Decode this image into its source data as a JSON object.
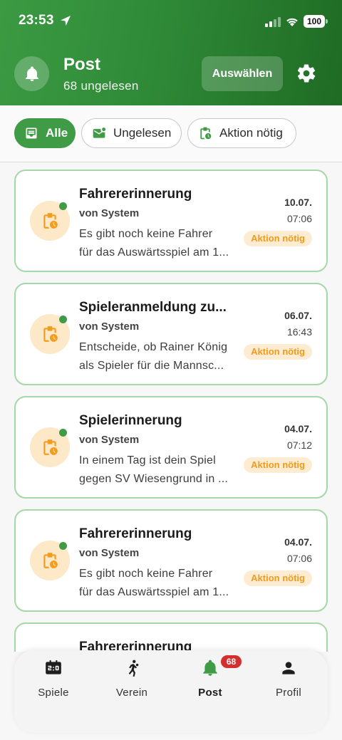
{
  "status_bar": {
    "time": "23:53",
    "battery": "100"
  },
  "header": {
    "title": "Post",
    "subtitle": "68 ungelesen",
    "select_label": "Auswählen"
  },
  "filters": [
    {
      "label": "Alle",
      "active": true
    },
    {
      "label": "Ungelesen",
      "active": false
    },
    {
      "label": "Aktion nötig",
      "active": false
    }
  ],
  "messages": [
    {
      "title": "Fahrererinnerung",
      "sender": "von System",
      "preview_1": "Es gibt noch keine Fahrer",
      "preview_2": "für das Auswärtsspiel am 1...",
      "date": "10.07.",
      "time": "07:06",
      "badge": "Aktion nötig"
    },
    {
      "title": "Spieleranmeldung zu...",
      "sender": "von System",
      "preview_1": "Entscheide, ob Rainer König",
      "preview_2": "als Spieler für die Mannsc...",
      "date": "06.07.",
      "time": "16:43",
      "badge": "Aktion nötig"
    },
    {
      "title": "Spielerinnerung",
      "sender": "von System",
      "preview_1": "In einem Tag ist dein Spiel",
      "preview_2": "gegen SV Wiesengrund in ...",
      "date": "04.07.",
      "time": "07:12",
      "badge": "Aktion nötig"
    },
    {
      "title": "Fahrererinnerung",
      "sender": "von System",
      "preview_1": "Es gibt noch keine Fahrer",
      "preview_2": "für das Auswärtsspiel am 1...",
      "date": "04.07.",
      "time": "07:06",
      "badge": "Aktion nötig"
    },
    {
      "title": "Fahrererinnerung",
      "sender": "",
      "preview_1": "",
      "preview_2": "",
      "date": "",
      "time": "",
      "badge": ""
    }
  ],
  "nav": {
    "items": [
      {
        "label": "Spiele"
      },
      {
        "label": "Verein"
      },
      {
        "label": "Post"
      },
      {
        "label": "Profil"
      }
    ],
    "post_badge": "68"
  },
  "colors": {
    "primary": "#3f9b45",
    "badge_bg": "#fdecd2",
    "badge_text": "#f19b1d",
    "unread_badge": "#d32f2f"
  }
}
